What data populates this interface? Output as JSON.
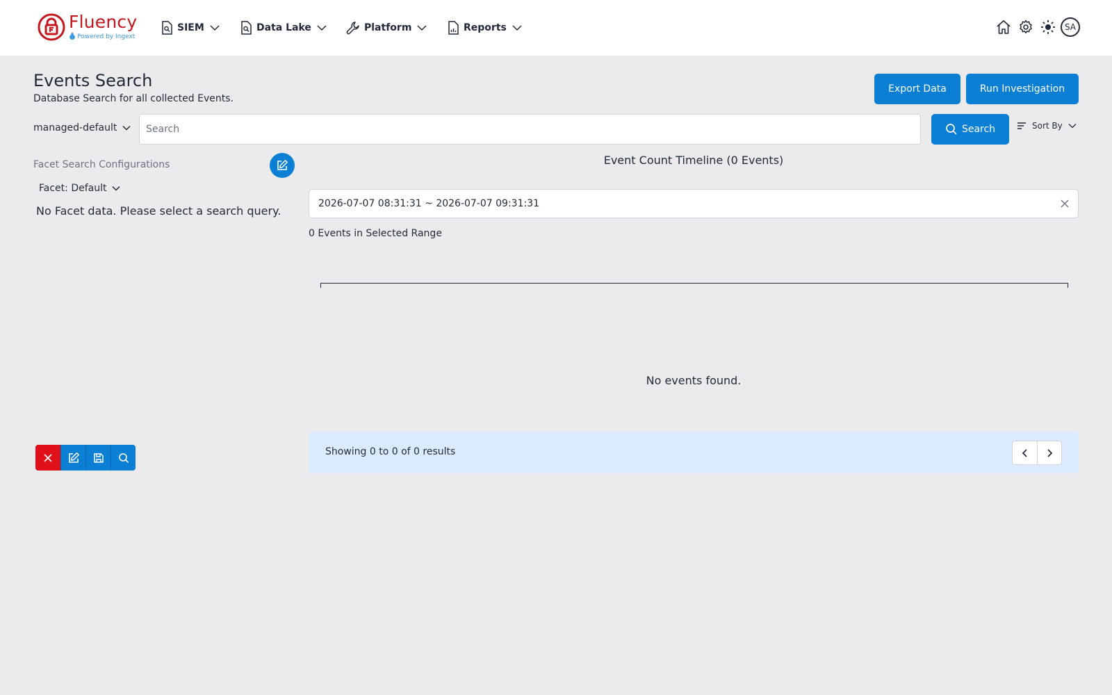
{
  "brand": {
    "name": "Fluency",
    "tagline": "Powered by Ingext",
    "color": "#c4161c"
  },
  "nav": [
    {
      "label": "SIEM",
      "icon": "document-search-icon"
    },
    {
      "label": "Data Lake",
      "icon": "document-search-icon"
    },
    {
      "label": "Platform",
      "icon": "wrench-icon"
    },
    {
      "label": "Reports",
      "icon": "report-chart-icon"
    }
  ],
  "top_icons": [
    "home-icon",
    "gear-icon",
    "sun-icon"
  ],
  "user": {
    "initials": "SA"
  },
  "page": {
    "title": "Events Search",
    "subtitle": "Database Search for all collected Events."
  },
  "actions": {
    "export_label": "Export Data",
    "investigate_label": "Run Investigation"
  },
  "search": {
    "database": "managed-default",
    "placeholder": "Search",
    "value": "",
    "button_label": "Search",
    "sort_label": "Sort By"
  },
  "facet": {
    "title": "Facet Search Configurations",
    "selected": "Facet: Default",
    "empty_message": "No Facet data. Please select a search query."
  },
  "timeline": {
    "title": "Event Count Timeline (0 Events)",
    "range": "2026-07-07 08:31:31 ~ 2026-07-07 09:31:31",
    "range_count": "0 Events in Selected Range"
  },
  "results": {
    "empty_message": "No events found.",
    "showing": "Showing 0 to 0 of 0 results"
  },
  "colors": {
    "primary": "#0a7fd4",
    "danger": "#e0101a",
    "background": "#ebebee",
    "pager_bg": "#dbeafe"
  }
}
